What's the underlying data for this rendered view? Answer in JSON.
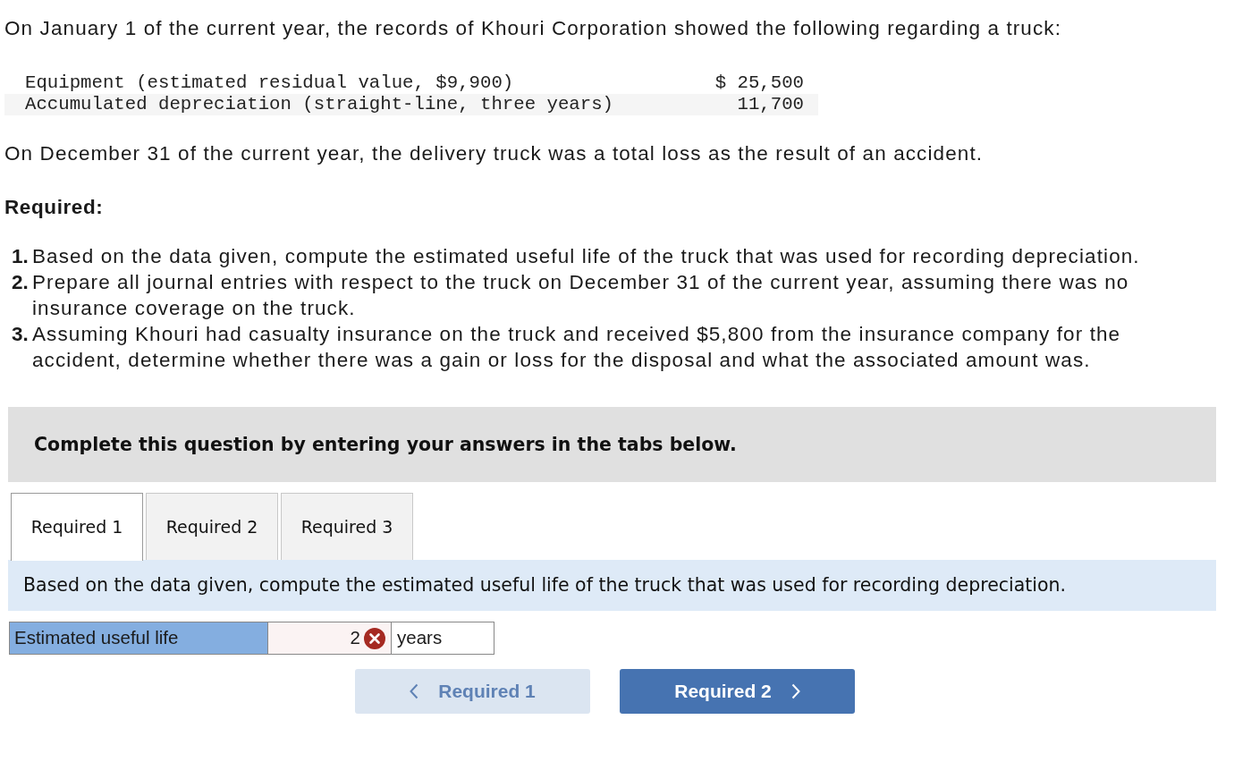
{
  "intro": "On January 1 of the current year, the records of Khouri Corporation showed the following regarding a truck:",
  "records": [
    {
      "label": "Equipment (estimated residual value, $9,900)",
      "amount": "$ 25,500"
    },
    {
      "label": "Accumulated depreciation (straight-line, three years)",
      "amount": "11,700"
    }
  ],
  "event": "On December 31 of the current year, the delivery truck was a total loss as the result of an accident.",
  "required_heading": "Required:",
  "requirements": [
    {
      "number": "1.",
      "text": "Based on the data given, compute the estimated useful life of the truck that was used for recording depreciation."
    },
    {
      "number": "2.",
      "text": "Prepare all journal entries with respect to the truck on December 31 of the current year, assuming there was no insurance coverage on the truck."
    },
    {
      "number": "3.",
      "text": "Assuming Khouri had casualty insurance on the truck and received $5,800 from the insurance company for the accident, determine whether there was a gain or loss for the disposal and what the associated amount was."
    }
  ],
  "instruction_banner": "Complete this question by entering your answers in the tabs below.",
  "tabs": [
    {
      "label": "Required 1",
      "selected": true
    },
    {
      "label": "Required 2",
      "selected": false
    },
    {
      "label": "Required 3",
      "selected": false
    }
  ],
  "prompt": "Based on the data given, compute the estimated useful life of the truck that was used for recording depreciation.",
  "answer_row": {
    "label": "Estimated useful life",
    "value": "2",
    "correct": false,
    "unit": "years"
  },
  "nav_buttons": [
    {
      "label": "Required 1",
      "kind": "previous",
      "disabled": true
    },
    {
      "label": "Required 2",
      "kind": "next",
      "disabled": false
    }
  ]
}
